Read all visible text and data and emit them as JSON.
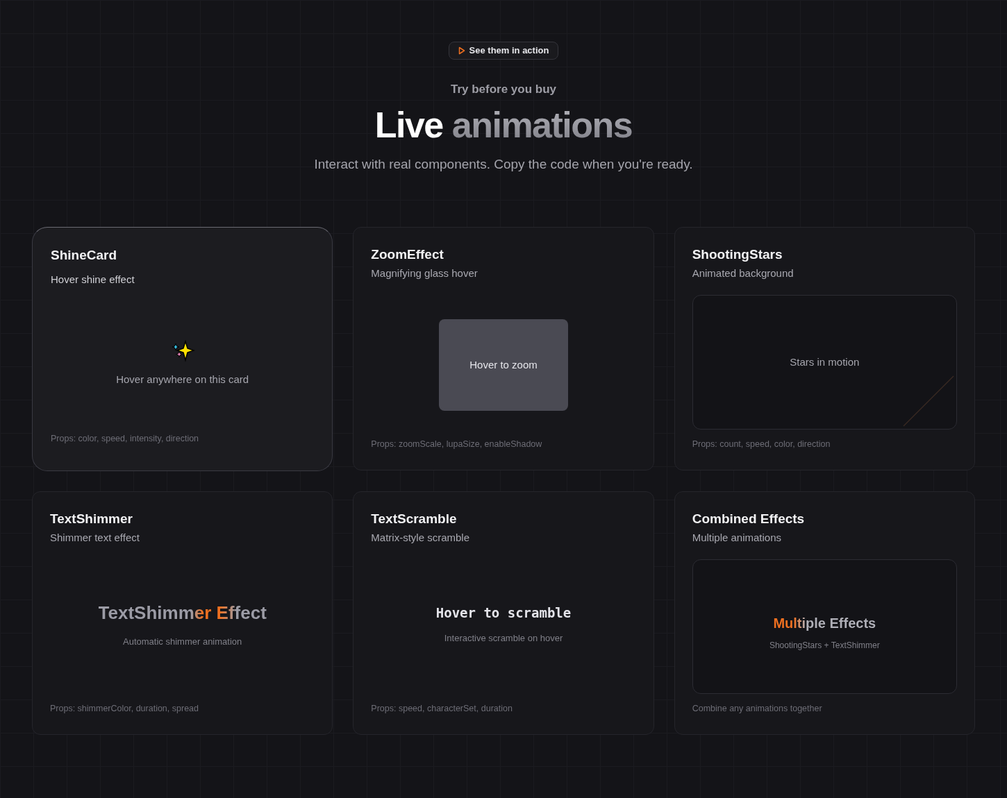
{
  "badge": {
    "label": "See them in action"
  },
  "eyebrow": "Try before you buy",
  "title": {
    "lead": "Live",
    "rest": "animations"
  },
  "subtitle": "Interact with real components. Copy the code when you're ready.",
  "cards": [
    {
      "kind": "shine",
      "highlighted": true,
      "title": "ShineCard",
      "subtitle": "Hover shine effect",
      "demo_text": "Hover anywhere on this card",
      "footer": "Props: color, speed, intensity, direction"
    },
    {
      "kind": "zoom",
      "highlighted": false,
      "title": "ZoomEffect",
      "subtitle": "Magnifying glass hover",
      "demo_text": "Hover to zoom",
      "footer": "Props: zoomScale, lupaSize, enableShadow"
    },
    {
      "kind": "stars",
      "highlighted": false,
      "title": "ShootingStars",
      "subtitle": "Animated background",
      "demo_text": "Stars in motion",
      "footer": "Props: count, speed, color, direction"
    },
    {
      "kind": "shimmer",
      "highlighted": false,
      "title": "TextShimmer",
      "subtitle": "Shimmer text effect",
      "demo_text": "TextShimmer Effect",
      "demo_caption": "Automatic shimmer animation",
      "footer": "Props: shimmerColor, duration, spread"
    },
    {
      "kind": "scramble",
      "highlighted": false,
      "title": "TextScramble",
      "subtitle": "Matrix-style scramble",
      "demo_text": "Hover to scramble",
      "demo_caption": "Interactive scramble on hover",
      "footer": "Props: speed, characterSet, duration"
    },
    {
      "kind": "combined",
      "highlighted": false,
      "title": "Combined Effects",
      "subtitle": "Multiple animations",
      "demo_text": "Multiple Effects",
      "demo_caption": "ShootingStars + TextShimmer",
      "footer": "Combine any animations together"
    }
  ]
}
